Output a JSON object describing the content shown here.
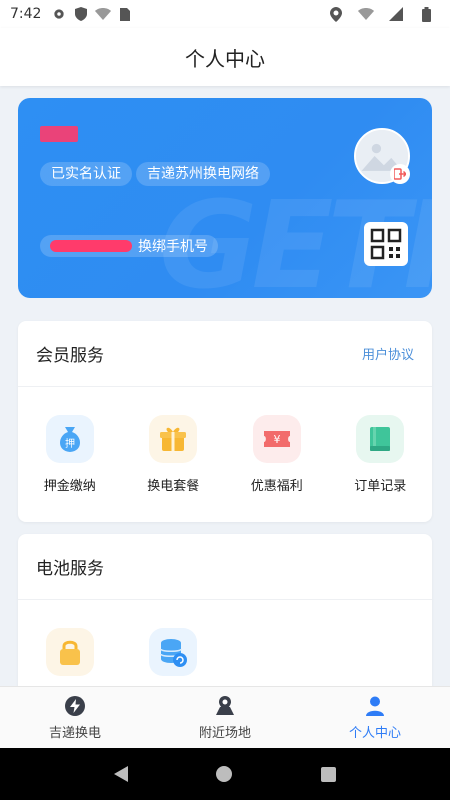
{
  "status_bar": {
    "time": "7:42"
  },
  "header": {
    "title": "个人中心"
  },
  "profile": {
    "tags": [
      "已实名认证",
      "吉递苏州换电网络"
    ],
    "phone_change": "换绑手机号"
  },
  "member_services": {
    "title": "会员服务",
    "link": "用户协议",
    "items": [
      {
        "label": "押金缴纳",
        "icon": "deposit-bag-icon"
      },
      {
        "label": "换电套餐",
        "icon": "gift-box-icon"
      },
      {
        "label": "优惠福利",
        "icon": "coupon-icon"
      },
      {
        "label": "订单记录",
        "icon": "book-icon"
      }
    ]
  },
  "battery_services": {
    "title": "电池服务",
    "items": [
      {
        "icon": "lock-icon"
      },
      {
        "icon": "database-sync-icon"
      }
    ]
  },
  "tabs": [
    {
      "label": "吉递换电",
      "icon": "lightning-icon",
      "active": false
    },
    {
      "label": "附近场地",
      "icon": "map-pin-icon",
      "active": false
    },
    {
      "label": "个人中心",
      "icon": "person-icon",
      "active": true
    }
  ],
  "colors": {
    "accent": "#2e8ff3",
    "active_tab": "#2e7cf6"
  }
}
